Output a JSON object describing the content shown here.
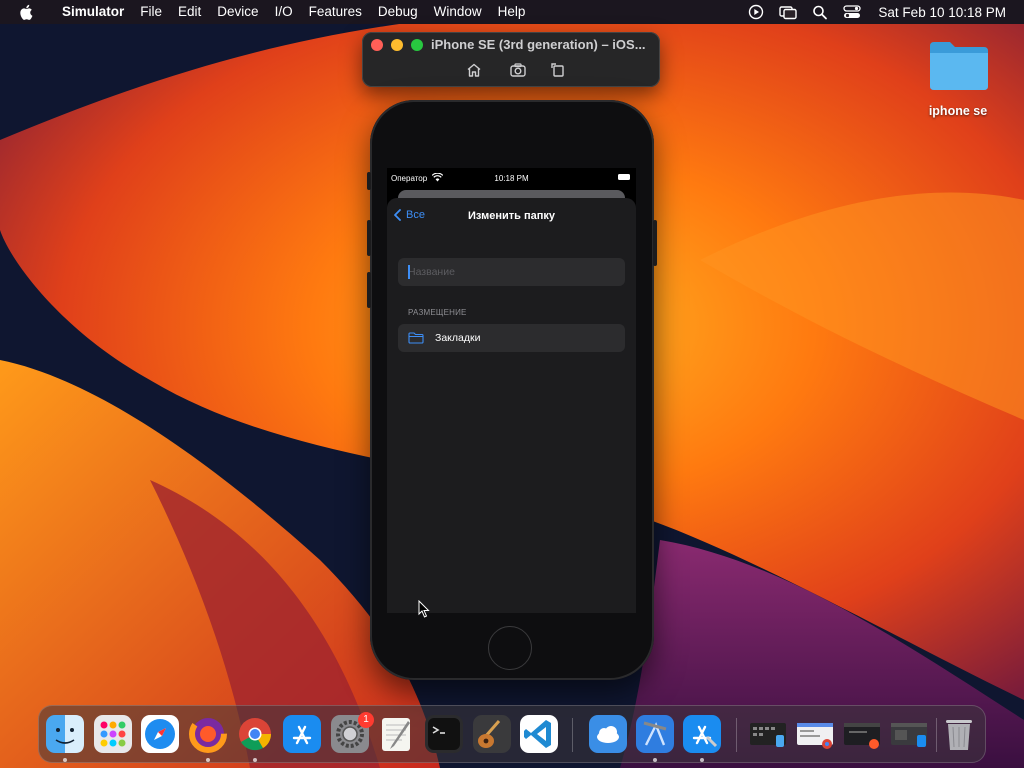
{
  "menubar": {
    "app_name": "Simulator",
    "items": [
      "File",
      "Edit",
      "Device",
      "I/O",
      "Features",
      "Debug",
      "Window",
      "Help"
    ],
    "clock": "Sat Feb 10  10:18 PM"
  },
  "simulator_window": {
    "title": "iPhone SE (3rd generation) – iOS..."
  },
  "desktop": {
    "folder_label": "iphone se"
  },
  "phone": {
    "status": {
      "carrier": "Оператор",
      "time": "10:18 PM"
    },
    "nav": {
      "back_label": "Все",
      "title": "Изменить папку"
    },
    "name_field": {
      "value": "",
      "placeholder": "Название"
    },
    "location": {
      "section_header": "РАЗМЕЩЕНИЕ",
      "folder_name": "Закладки"
    }
  },
  "dock": {
    "settings_badge": "1"
  },
  "colors": {
    "accent": "#3d8ef6",
    "sheet_bg": "#1c1c1e",
    "cell_bg": "#2c2c2e"
  }
}
